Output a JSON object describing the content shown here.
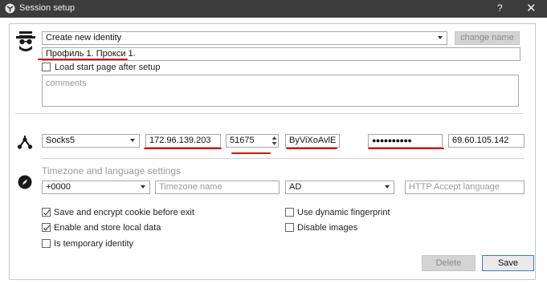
{
  "window": {
    "title": "Session setup",
    "help_glyph": "?",
    "close_glyph": "✕"
  },
  "identity": {
    "select_value": "Create new identity",
    "change_name_label": "change name",
    "name_value": "Профиль 1. Прокси 1.",
    "load_start_page_label": "Load start page after setup",
    "load_start_page_checked": false,
    "comments_placeholder": "comments"
  },
  "proxy": {
    "type": "Socks5",
    "host": "172.96.139.203",
    "port": "51675",
    "login": "ByViXoAvlE",
    "password_mask": "●●●●●●●●●●",
    "external_ip": "69.60.105.142"
  },
  "timezone": {
    "section_title": "Timezone and language settings",
    "offset_value": "+0000",
    "timezone_placeholder": "Timezone name",
    "language_value": "AD",
    "accept_language_placeholder": "HTTP Accept language"
  },
  "options": {
    "save_cookie_label": "Save and encrypt cookie before exit",
    "save_cookie_checked": true,
    "local_data_label": "Enable and store local data",
    "local_data_checked": true,
    "temporary_label": "Is temporary identity",
    "temporary_checked": false,
    "dynamic_fp_label": "Use dynamic fingerprint",
    "dynamic_fp_checked": false,
    "disable_images_label": "Disable images",
    "disable_images_checked": false
  },
  "footer": {
    "delete_label": "Delete",
    "save_label": "Save"
  },
  "icons": {
    "title": "app-logo-icon",
    "identity": "incognito-avatar-icon",
    "proxy": "network-nodes-icon",
    "timezone": "compass-icon"
  },
  "colors": {
    "titlebar": "#3c3c3c",
    "annotation_red": "#d61515",
    "save_border": "#3a7bd5"
  }
}
